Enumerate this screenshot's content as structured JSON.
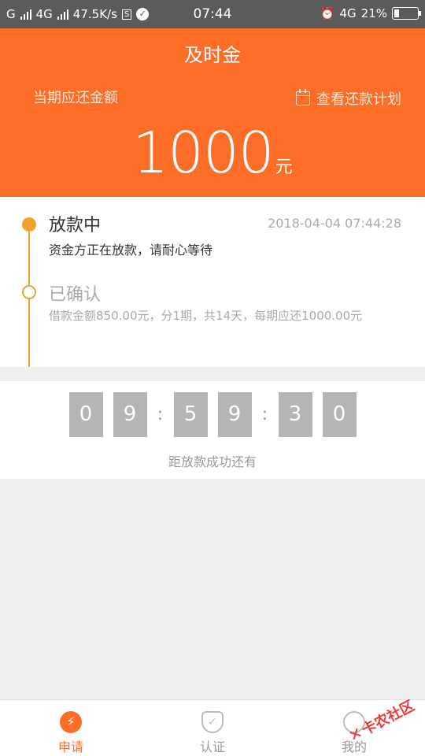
{
  "status_bar": {
    "carrier1": "G",
    "carrier2": "4G",
    "speed": "47.5K/s",
    "sbox": "S",
    "time": "07:44",
    "network": "4G",
    "battery": "21%"
  },
  "header": {
    "title": "及时金",
    "amount_label": "当期应还金额",
    "plan_link": "查看还款计划",
    "amount": "1000",
    "unit": "元"
  },
  "timeline": {
    "steps": [
      {
        "title": "放款中",
        "desc": "资金方正在放款，请耐心等待",
        "time": "2018-04-04 07:44:28"
      },
      {
        "title": "已确认",
        "desc": "借款金额850.00元，分1期，共14天，每期应还1000.00元"
      }
    ]
  },
  "countdown": {
    "digits": [
      "0",
      "9",
      "5",
      "9",
      "3",
      "0"
    ],
    "separator": ":",
    "label": "距放款成功还有"
  },
  "tabs": [
    {
      "label": "申请",
      "icon": "bolt-icon",
      "active": true
    },
    {
      "label": "认证",
      "icon": "shield-check-icon",
      "active": false
    },
    {
      "label": "我的",
      "icon": "user-icon",
      "active": false
    }
  ],
  "watermark": "卡农社区",
  "colors": {
    "accent": "#fc6e28",
    "timeline": "#f0a32c",
    "digit_bg": "#b5b5b5",
    "status_bar": "#5b5b5b"
  }
}
